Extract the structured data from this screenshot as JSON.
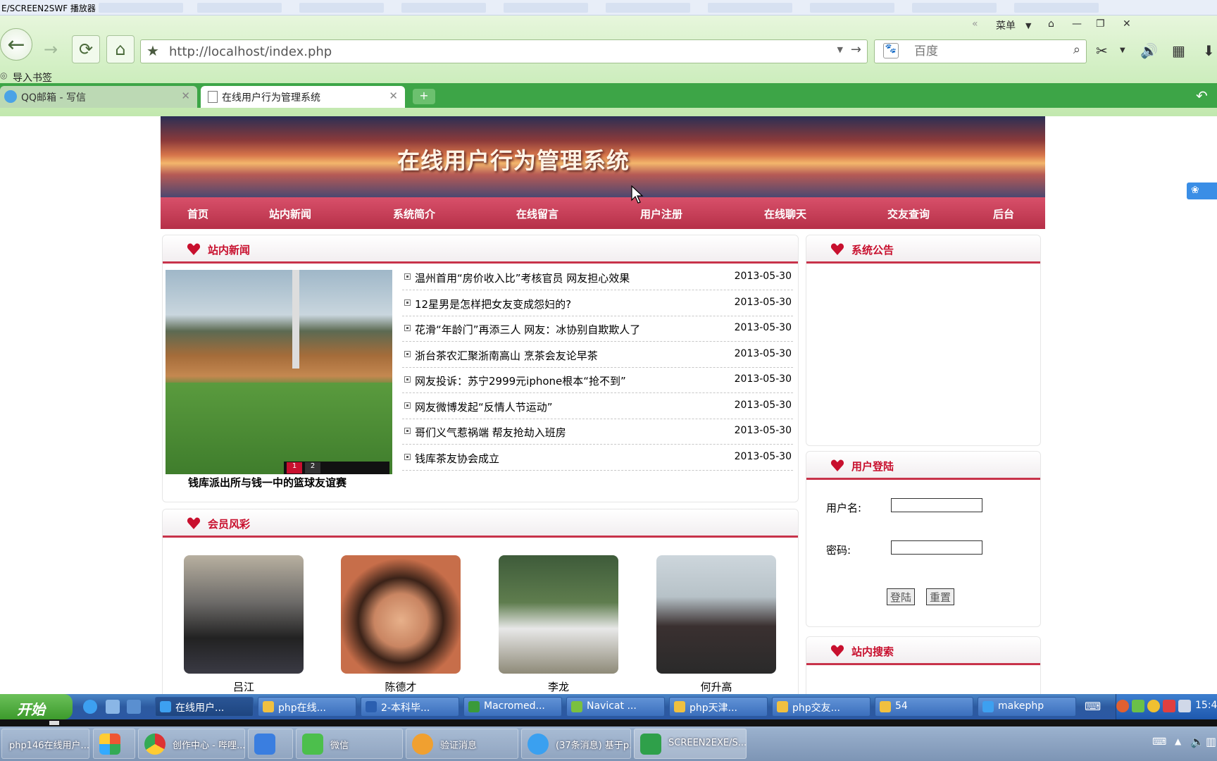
{
  "recorder": {
    "title": "E/SCREEN2SWF 播放器"
  },
  "browser": {
    "menu_label": "菜单",
    "address_url": "http://localhost/index.php",
    "search_placeholder": "百度",
    "bookmark_import": "导入书签",
    "tabs": [
      {
        "label": "QQ邮箱 - 写信"
      },
      {
        "label": "在线用户行为管理系统"
      }
    ]
  },
  "site": {
    "banner_title": "在线用户行为管理系统",
    "nav": [
      "首页",
      "站内新闻",
      "系统简介",
      "在线留言",
      "用户注册",
      "在线聊天",
      "交友查询",
      "后台"
    ],
    "news_panel": {
      "title": "站内新闻",
      "slide_caption": "钱库派出所与钱一中的篮球友谊赛",
      "slide_pages": [
        "1",
        "2"
      ],
      "items": [
        {
          "title": "温州首用“房价收入比”考核官员 网友担心效果",
          "date": "2013-05-30"
        },
        {
          "title": "12星男是怎样把女友变成怨妇的?",
          "date": "2013-05-30"
        },
        {
          "title": "花滑“年龄门”再添三人 网友：冰协别自欺欺人了",
          "date": "2013-05-30"
        },
        {
          "title": "浙台茶农汇聚浙南高山 烹茶会友论早茶",
          "date": "2013-05-30"
        },
        {
          "title": "网友投诉：苏宁2999元iphone根本“抢不到”",
          "date": "2013-05-30"
        },
        {
          "title": "网友微博发起“反情人节运动”",
          "date": "2013-05-30"
        },
        {
          "title": "哥们义气惹祸端 帮友抢劫入班房",
          "date": "2013-05-30"
        },
        {
          "title": "钱库茶友协会成立",
          "date": "2013-05-30"
        }
      ]
    },
    "members_panel": {
      "title": "会员风彩",
      "members": [
        {
          "name": "吕江"
        },
        {
          "name": "陈德才"
        },
        {
          "name": "李龙"
        },
        {
          "name": "何升高"
        }
      ]
    },
    "notice_panel": {
      "title": "系统公告"
    },
    "login_panel": {
      "title": "用户登陆",
      "username_label": "用户名:",
      "password_label": "密码:",
      "login_button": "登陆",
      "reset_button": "重置"
    },
    "search_panel": {
      "title": "站内搜索"
    }
  },
  "taskbar": {
    "start_label": "开始",
    "items": [
      "在线用户...",
      "php在线...",
      "2-本科毕...",
      "Macromed...",
      "Navicat ...",
      "php天津...",
      "php交友...",
      "54",
      "makephp"
    ],
    "clock": "15:4"
  },
  "win7_taskbar": {
    "items": [
      "php146在线用户...",
      "",
      "创作中心 - 哔哩...",
      "",
      "微信",
      "验证消息",
      "(37条消息) 基于p...",
      "SCREEN2EXE/S..."
    ]
  },
  "colors": {
    "nav": "#c33a54",
    "accent": "#c8102e",
    "browser_green": "#3da547"
  }
}
